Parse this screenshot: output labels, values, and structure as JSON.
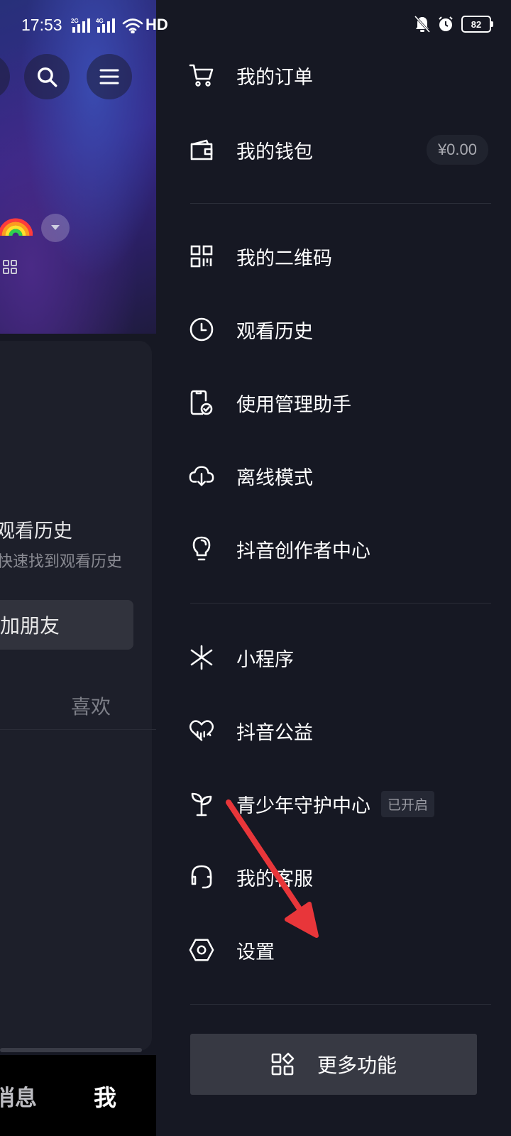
{
  "status_bar": {
    "time": "17:53",
    "network_1": "2G",
    "network_2": "4G",
    "hd": "HD",
    "battery": "82"
  },
  "background_page": {
    "history_title": "观看历史",
    "history_subtitle": "快速找到观看历史",
    "add_friends_button": "加朋友",
    "tab_likes": "喜欢",
    "bottom_tab_messages": "消息",
    "bottom_tab_me": "我"
  },
  "drawer": {
    "items": [
      {
        "label": "我的订单",
        "icon": "cart-icon"
      },
      {
        "label": "我的钱包",
        "icon": "wallet-icon",
        "amount": "¥0.00"
      },
      {
        "label": "我的二维码",
        "icon": "qr-code-icon"
      },
      {
        "label": "观看历史",
        "icon": "clock-icon"
      },
      {
        "label": "使用管理助手",
        "icon": "phone-check-icon"
      },
      {
        "label": "离线模式",
        "icon": "cloud-download-icon"
      },
      {
        "label": "抖音创作者中心",
        "icon": "lightbulb-icon"
      },
      {
        "label": "小程序",
        "icon": "asterisk-icon"
      },
      {
        "label": "抖音公益",
        "icon": "heart-icon"
      },
      {
        "label": "青少年守护中心",
        "icon": "sprout-icon",
        "tag": "已开启"
      },
      {
        "label": "我的客服",
        "icon": "headset-icon"
      },
      {
        "label": "设置",
        "icon": "settings-hex-icon"
      }
    ],
    "more_button": "更多功能"
  },
  "colors": {
    "background": "#161823",
    "annotation_arrow": "#e8363a",
    "button_bg": "#373943"
  }
}
